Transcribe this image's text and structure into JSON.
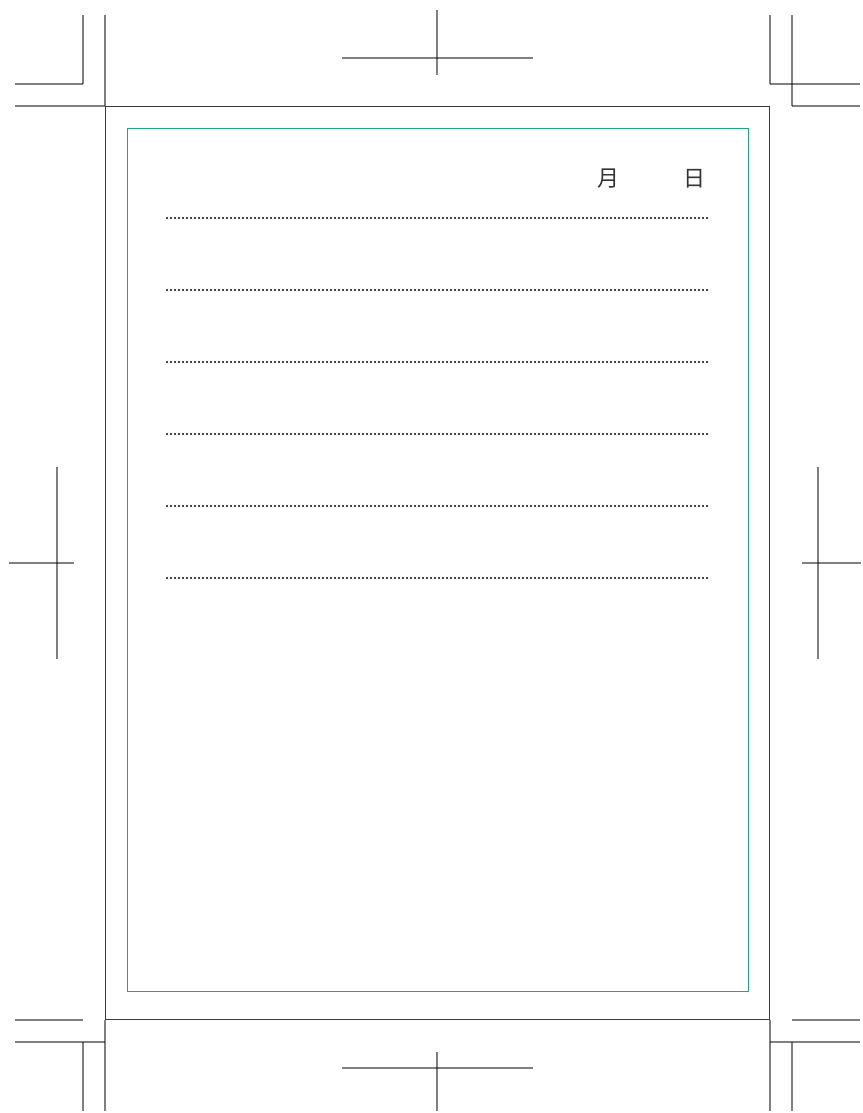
{
  "header": {
    "month_label": "月",
    "day_label": "日"
  },
  "colors": {
    "content_border": "#1fa67a",
    "trim_marks": "#000000",
    "page_frame": "#3a3a3a",
    "dotted_lines": "#444444"
  },
  "writing_lines": {
    "count": 6,
    "style": "dotted"
  }
}
